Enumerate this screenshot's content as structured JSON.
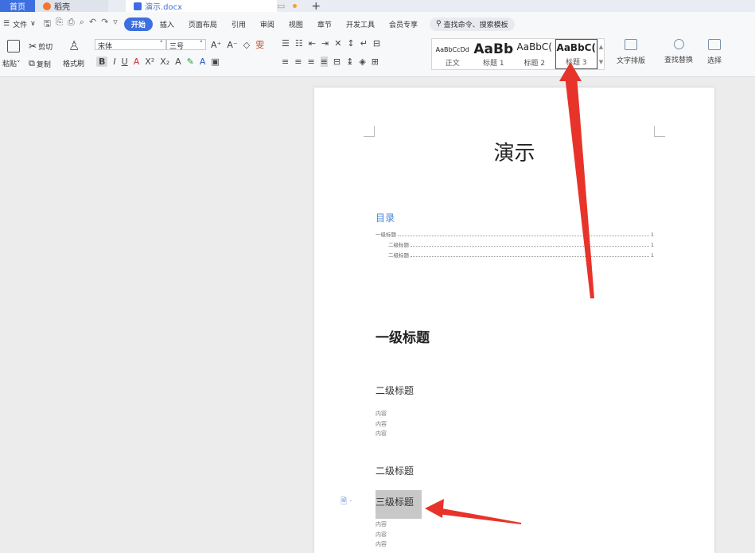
{
  "tabs": {
    "home": "首页",
    "doc1": "稻壳",
    "doc2": "演示.docx"
  },
  "menu": {
    "file": "文件",
    "items": [
      "开始",
      "插入",
      "页面布局",
      "引用",
      "审阅",
      "视图",
      "章节",
      "开发工具",
      "会员专享"
    ],
    "search": "查找命令、搜索模板"
  },
  "ribbon": {
    "paste": "粘贴",
    "cut": "剪切",
    "copy": "复制",
    "format_painter": "格式刷",
    "font_name": "宋体",
    "font_size": "三号",
    "styles": [
      {
        "sample": "AaBbCcDd",
        "label": "正文"
      },
      {
        "sample": "AaBb",
        "label": "标题 1"
      },
      {
        "sample": "AaBbC(",
        "label": "标题 2"
      },
      {
        "sample": "AaBbC(",
        "label": "标题 3"
      }
    ],
    "text_layout": "文字排版",
    "find_replace": "查找替换",
    "select": "选择"
  },
  "document": {
    "title": "演示",
    "toc_title": "目录",
    "toc": [
      {
        "text": "一级标题",
        "page": "1"
      },
      {
        "text": "二级标题",
        "page": "1"
      },
      {
        "text": "二级标题",
        "page": "1"
      }
    ],
    "heading1": "一级标题",
    "heading2a": "二级标题",
    "content_a": [
      "内容",
      "内容",
      "内容"
    ],
    "heading2b": "二级标题",
    "heading3": "三级标题",
    "content_b": [
      "内容",
      "内容",
      "内容"
    ]
  },
  "colors": {
    "accent": "#3d6fe0",
    "arrow": "#e8332a",
    "toc": "#4a7fd8"
  }
}
